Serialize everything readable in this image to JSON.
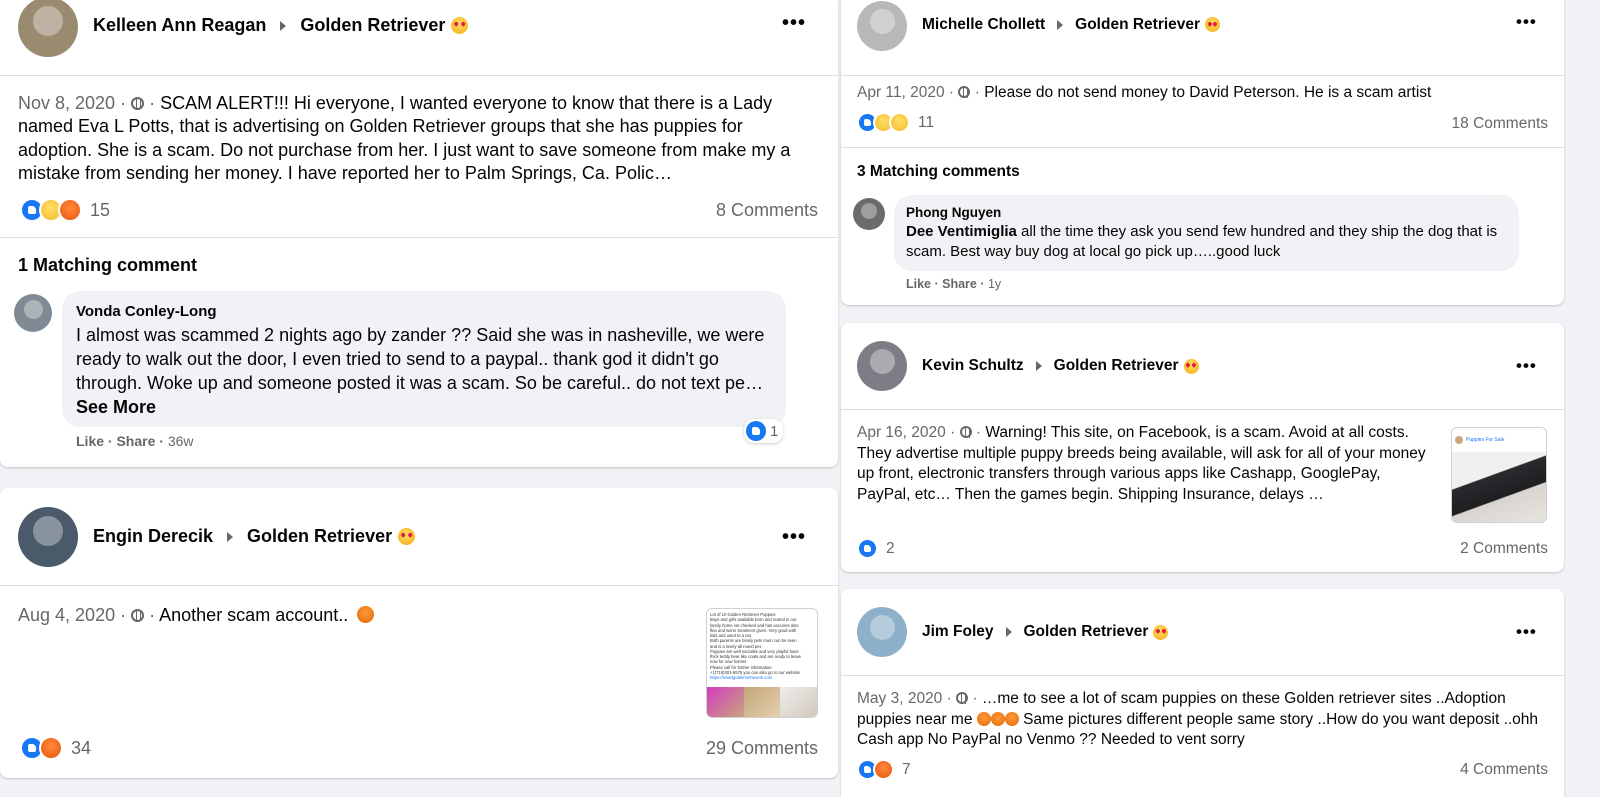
{
  "colors": {
    "accent": "#1877f2",
    "meta_text": "#65676b",
    "bubble_bg": "#f0f2f5",
    "page_bg": "#f0f2f5"
  },
  "posts": [
    {
      "author": "Kelleen Ann Reagan",
      "group": "Golden Retriever",
      "group_icon": "heart-eyes-emoji",
      "date": "Nov 8, 2020 ·",
      "text_sep": "·",
      "text": "SCAM ALERT!!! Hi everyone, I wanted everyone to know that there is a Lady named Eva L Potts, that is advertising on Golden Retriever groups that she has puppies for adoption. She is a scam. Do not purchase from her. I just want to save someone from make my a mistake from sending her money. I have reported her to Palm Springs, Ca. Polic…",
      "reactions": [
        "like",
        "sad",
        "angry"
      ],
      "reaction_count": "15",
      "comments": "8 Comments",
      "matching_label": "1 Matching comment",
      "comment": {
        "name": "Vonda Conley-Long",
        "text": "I almost was scammed 2 nights ago by zander ?? Said she was in nasheville, we were ready to walk out the door, I even tried to send to a paypal.. thank god it didn't go through. Woke up and someone posted it was a scam. So be careful.. do not text pe…",
        "see_more": "See More",
        "like": "Like",
        "share": "Share",
        "time": "36w",
        "reaction_count": "1"
      }
    },
    {
      "author": "Engin Derecik",
      "group": "Golden Retriever",
      "group_icon": "heart-eyes-emoji",
      "date": "Aug 4, 2020 ·",
      "text_sep": "·",
      "text": "Another scam account..",
      "text_emoji": "angry-emoji",
      "thumb_lines": [
        "Lot of 10 Golden Retriever Puppies",
        "Boys and girls available born and reared in our",
        "family home vet checked and has vaccines also",
        "flea and worm treatment given. Very good with",
        "kids and used to a cat.",
        "Both parents are family pets mum can be seen",
        "and is a lovely all round pet.",
        "Puppies are well socialise and very playful have",
        "thick teddy bear like coats and are ready to leave",
        "now for new homes",
        "Please call for further information:",
        "+1(719)301-6575 you can also go to our website",
        "https://smartgoldenretrievers.com"
      ],
      "reactions": [
        "like",
        "angry"
      ],
      "reaction_count": "34",
      "comments": "29 Comments"
    },
    {
      "author": "Michelle Chollett",
      "group": "Golden Retriever",
      "group_icon": "heart-eyes-emoji",
      "date": "Apr 11, 2020 ·",
      "text_sep": "·",
      "text": "Please do not send money to David Peterson. He is a scam artist",
      "reactions": [
        "like",
        "wow",
        "sad"
      ],
      "reaction_count": "11",
      "comments": "18 Comments",
      "matching_label": "3 Matching comments",
      "comment": {
        "name": "Phong Nguyen",
        "mention": "Dee Ventimiglia",
        "text": "all the time they ask you send few hundred and they ship the dog that is scam. Best way buy dog at local go pick up…..good luck",
        "like": "Like",
        "share": "Share",
        "time": "1y"
      }
    },
    {
      "author": "Kevin Schultz",
      "group": "Golden Retriever",
      "group_icon": "heart-eyes-emoji",
      "date": "Apr 16, 2020 ·",
      "text_sep": "·",
      "text": "Warning! This site, on Facebook, is a scam. Avoid at all costs. They advertise multiple puppy breeds being available, will ask for all of your money up front, electronic transfers through various apps like Cashapp, GooglePay, PayPal, etc… Then the games begin. Shipping Insurance, delays …",
      "thumb_title": "Puppies For Sale",
      "reactions": [
        "like"
      ],
      "reaction_count": "2",
      "comments": "2 Comments"
    },
    {
      "author": "Jim Foley",
      "group": "Golden Retriever",
      "group_icon": "heart-eyes-emoji",
      "date": "May 3, 2020 ·",
      "text_sep": "·",
      "text_a": "…me to see a lot of scam puppies on these Golden retriever sites ..Adoption puppies near me",
      "text_b": "Same pictures different people same story ..How do you want deposit ..ohh Cash app No PayPal no Venmo ?? Needed to vent sorry",
      "reactions": [
        "like",
        "angry"
      ],
      "reaction_count": "7",
      "comments": "4 Comments"
    }
  ]
}
